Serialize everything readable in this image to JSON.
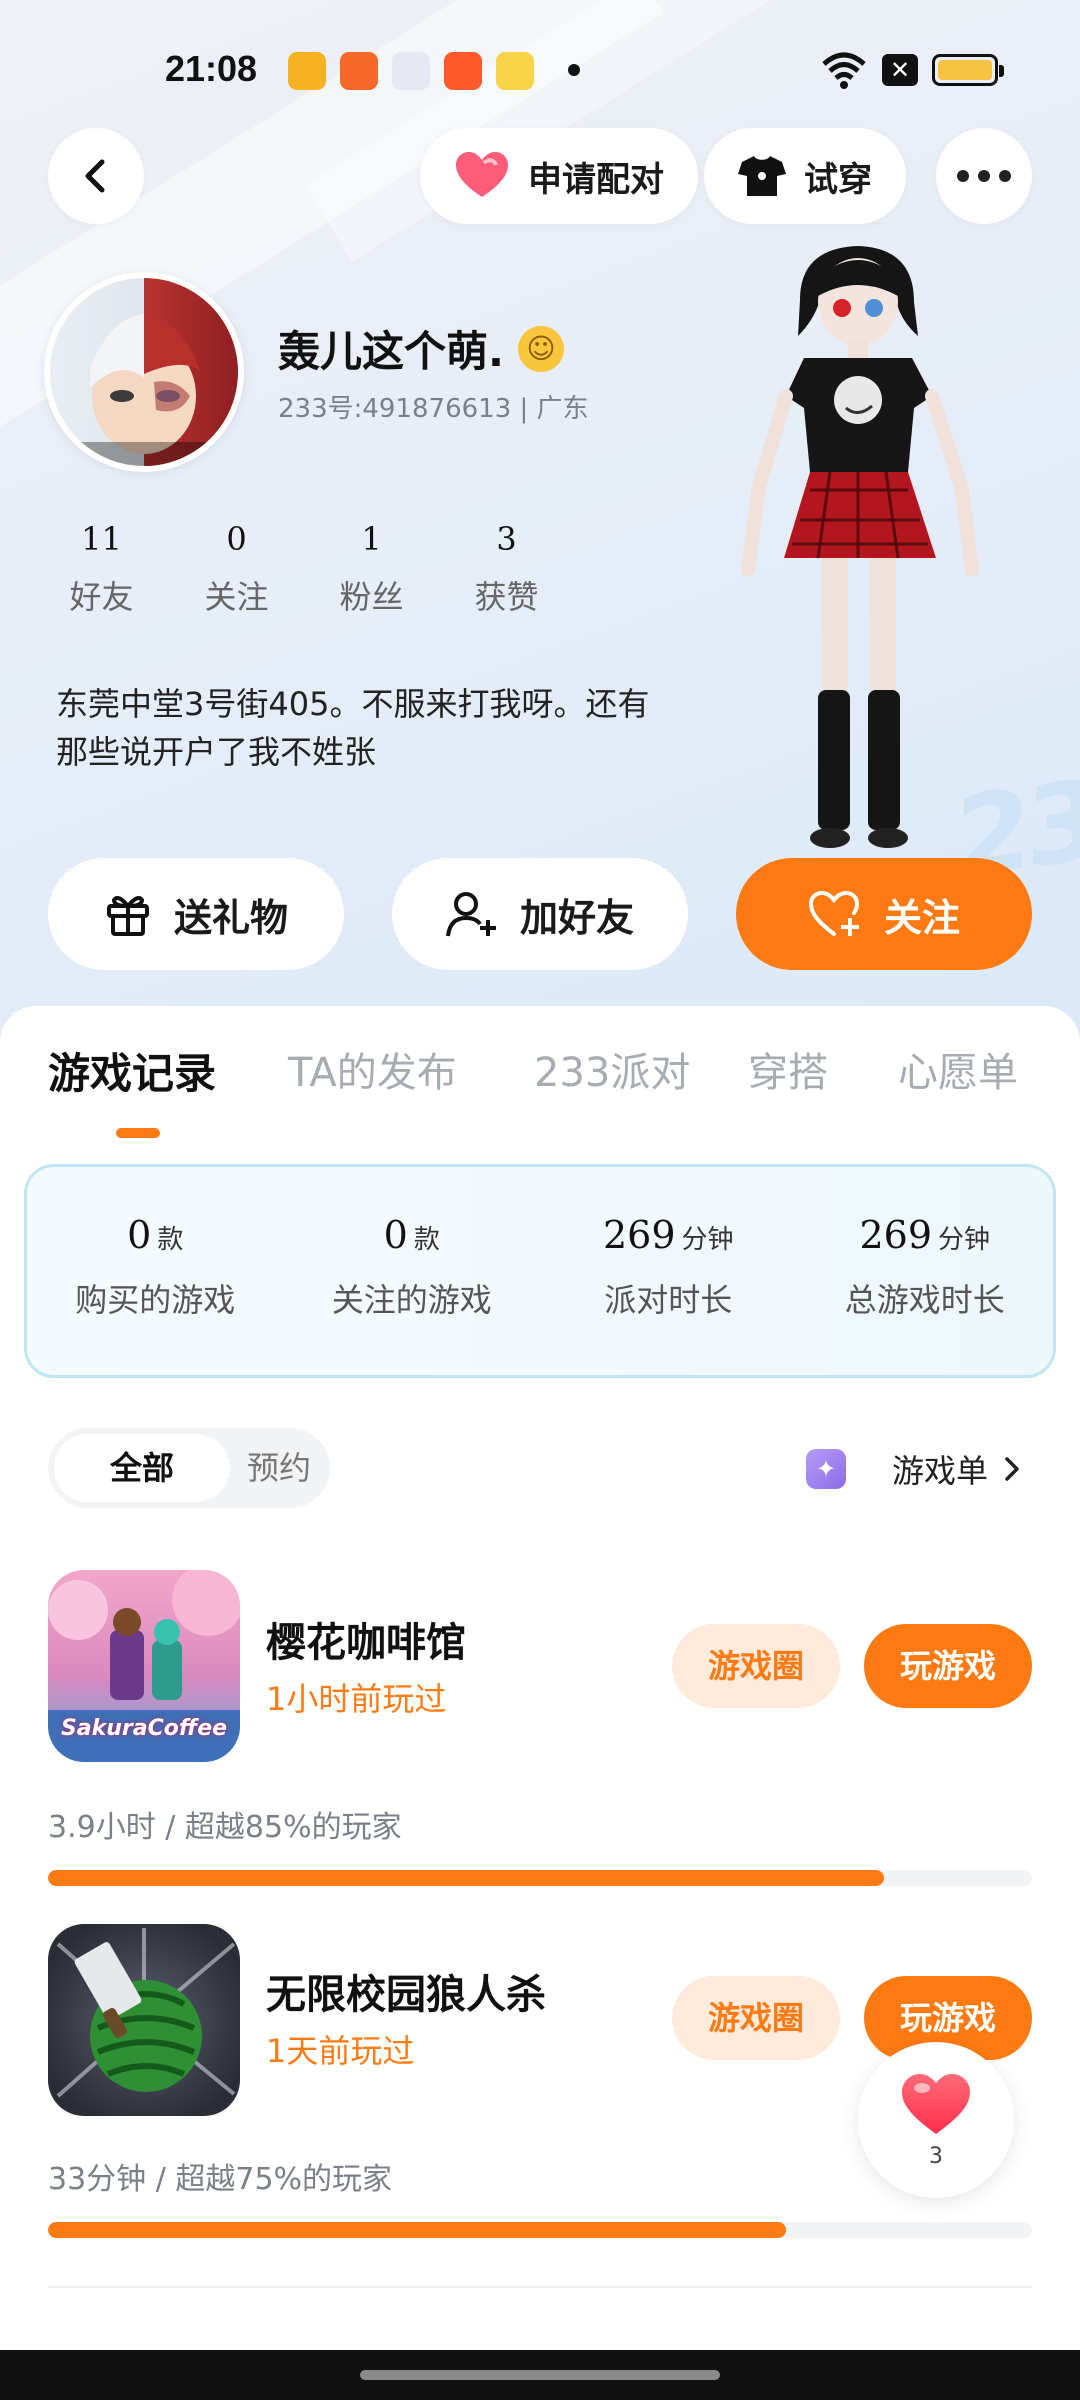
{
  "status_bar": {
    "time": "21:08"
  },
  "nav": {
    "pair_label": "申请配对",
    "tryon_label": "试穿"
  },
  "profile": {
    "name": "轰儿这个萌.",
    "id_line": "233号:491876613 | 广东",
    "stats": [
      {
        "num": "11",
        "label": "好友"
      },
      {
        "num": "0",
        "label": "关注"
      },
      {
        "num": "1",
        "label": "粉丝"
      },
      {
        "num": "3",
        "label": "获赞"
      }
    ],
    "bio_line1": "东莞中堂3号街405。不服来打我呀。还有",
    "bio_line2": "那些说开户了我不姓张"
  },
  "actions": {
    "gift_label": "送礼物",
    "add_friend_label": "加好友",
    "follow_label": "关注"
  },
  "tabs": [
    "游戏记录",
    "TA的发布",
    "233派对",
    "穿搭",
    "心愿单"
  ],
  "summary": [
    {
      "value": "0",
      "unit": "款",
      "label": "购买的游戏"
    },
    {
      "value": "0",
      "unit": "款",
      "label": "关注的游戏"
    },
    {
      "value": "269",
      "unit": "分钟",
      "label": "派对时长"
    },
    {
      "value": "269",
      "unit": "分钟",
      "label": "总游戏时长"
    }
  ],
  "filter": {
    "all": "全部",
    "reserved": "预约"
  },
  "game_list_link": "游戏单",
  "games": [
    {
      "name": "樱花咖啡馆",
      "last_played": "1小时前玩过",
      "circle_label": "游戏圈",
      "play_label": "玩游戏",
      "stat": "3.9小时 / 超越85%的玩家",
      "progress": 0.85,
      "icon_text": "SakuraCoffee"
    },
    {
      "name": "无限校园狼人杀",
      "last_played": "1天前玩过",
      "circle_label": "游戏圈",
      "play_label": "玩游戏",
      "stat": "33分钟 / 超越75%的玩家",
      "progress": 0.75
    }
  ],
  "like_count": "3",
  "colors": {
    "accent": "#ff7a12",
    "accent_light": "#ffeadb"
  }
}
